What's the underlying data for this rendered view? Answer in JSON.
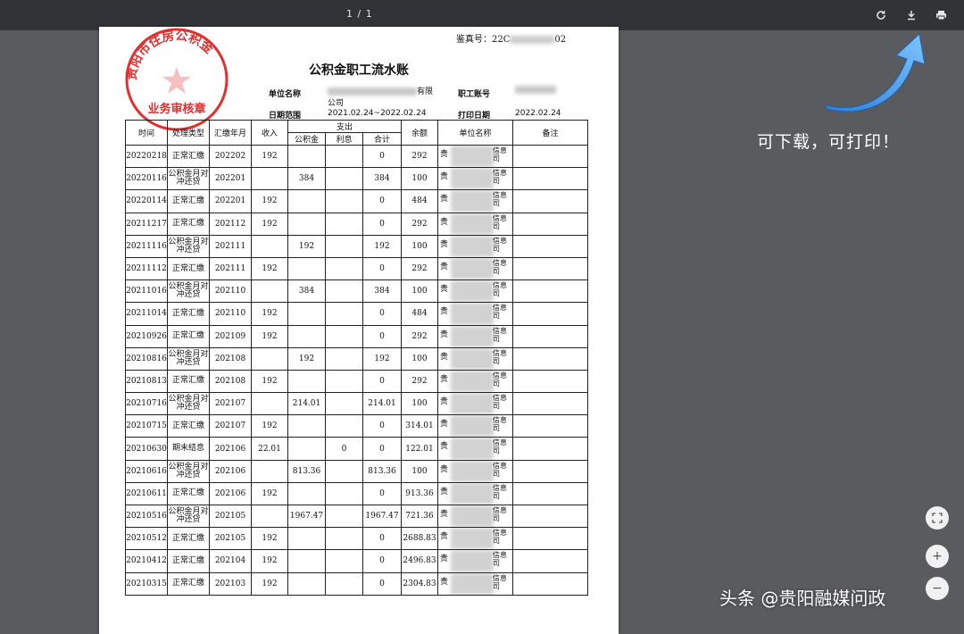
{
  "toolbar": {
    "page_count": "1 / 1",
    "rotate_icon": "rotate-icon",
    "download_icon": "download-icon",
    "print_icon": "print-icon"
  },
  "document": {
    "fax_label": "鉴真号：22C",
    "fax_suffix": "02",
    "seal_text": "贵阳市住房公积金",
    "seal_subtext": "业务审核章",
    "title": "公积金职工流水账",
    "meta": {
      "unit_label": "单位名称",
      "unit_value_a": "有限",
      "unit_value_b": "公司",
      "account_label": "职工账号",
      "date_range_label": "日期范围",
      "date_range_value": "2021.02.24~2022.02.24",
      "print_date_label": "打印日期",
      "print_date_value": "2022.02.24"
    },
    "headers": {
      "time": "时间",
      "type": "处理类型",
      "month": "汇缴年月",
      "income": "收入",
      "expense": "支出",
      "fund": "公积金",
      "interest": "利息",
      "total": "合计",
      "balance": "余额",
      "unit": "单位名称",
      "remark": "备注"
    },
    "unit_prefix": "贵",
    "unit_suffix": "信息司",
    "rows": [
      {
        "time": "20220218",
        "type": "正常汇缴",
        "month": "202202",
        "income": "192",
        "fund": "",
        "interest": "",
        "total": "0",
        "balance": "292"
      },
      {
        "time": "20220116",
        "type": "公积金月对冲还贷",
        "month": "202201",
        "income": "",
        "fund": "384",
        "interest": "",
        "total": "384",
        "balance": "100"
      },
      {
        "time": "20220114",
        "type": "正常汇缴",
        "month": "202201",
        "income": "192",
        "fund": "",
        "interest": "",
        "total": "0",
        "balance": "484"
      },
      {
        "time": "20211217",
        "type": "正常汇缴",
        "month": "202112",
        "income": "192",
        "fund": "",
        "interest": "",
        "total": "0",
        "balance": "292"
      },
      {
        "time": "20211116",
        "type": "公积金月对冲还贷",
        "month": "202111",
        "income": "",
        "fund": "192",
        "interest": "",
        "total": "192",
        "balance": "100"
      },
      {
        "time": "20211112",
        "type": "正常汇缴",
        "month": "202111",
        "income": "192",
        "fund": "",
        "interest": "",
        "total": "0",
        "balance": "292"
      },
      {
        "time": "20211016",
        "type": "公积金月对冲还贷",
        "month": "202110",
        "income": "",
        "fund": "384",
        "interest": "",
        "total": "384",
        "balance": "100"
      },
      {
        "time": "20211014",
        "type": "正常汇缴",
        "month": "202110",
        "income": "192",
        "fund": "",
        "interest": "",
        "total": "0",
        "balance": "484"
      },
      {
        "time": "20210926",
        "type": "正常汇缴",
        "month": "202109",
        "income": "192",
        "fund": "",
        "interest": "",
        "total": "0",
        "balance": "292"
      },
      {
        "time": "20210816",
        "type": "公积金月对冲还贷",
        "month": "202108",
        "income": "",
        "fund": "192",
        "interest": "",
        "total": "192",
        "balance": "100"
      },
      {
        "time": "20210813",
        "type": "正常汇缴",
        "month": "202108",
        "income": "192",
        "fund": "",
        "interest": "",
        "total": "0",
        "balance": "292"
      },
      {
        "time": "20210716",
        "type": "公积金月对冲还贷",
        "month": "202107",
        "income": "",
        "fund": "214.01",
        "interest": "",
        "total": "214.01",
        "balance": "100"
      },
      {
        "time": "20210715",
        "type": "正常汇缴",
        "month": "202107",
        "income": "192",
        "fund": "",
        "interest": "",
        "total": "0",
        "balance": "314.01"
      },
      {
        "time": "20210630",
        "type": "期末结息",
        "month": "202106",
        "income": "22.01",
        "fund": "",
        "interest": "0",
        "total": "0",
        "balance": "122.01"
      },
      {
        "time": "20210616",
        "type": "公积金月对冲还贷",
        "month": "202106",
        "income": "",
        "fund": "813.36",
        "interest": "",
        "total": "813.36",
        "balance": "100"
      },
      {
        "time": "20210611",
        "type": "正常汇缴",
        "month": "202106",
        "income": "192",
        "fund": "",
        "interest": "",
        "total": "0",
        "balance": "913.36"
      },
      {
        "time": "20210516",
        "type": "公积金月对冲还贷",
        "month": "202105",
        "income": "",
        "fund": "1967.47",
        "interest": "",
        "total": "1967.47",
        "balance": "721.36"
      },
      {
        "time": "20210512",
        "type": "正常汇缴",
        "month": "202105",
        "income": "192",
        "fund": "",
        "interest": "",
        "total": "0",
        "balance": "2688.83"
      },
      {
        "time": "20210412",
        "type": "正常汇缴",
        "month": "202104",
        "income": "192",
        "fund": "",
        "interest": "",
        "total": "0",
        "balance": "2496.83"
      },
      {
        "time": "20210315",
        "type": "正常汇缴",
        "month": "202103",
        "income": "192",
        "fund": "",
        "interest": "",
        "total": "0",
        "balance": "2304.83"
      }
    ]
  },
  "annotation": {
    "text": "可下载，可打印！",
    "arrow_color": "#3a8ee6"
  },
  "side_controls": {
    "fit_icon": "fit-page-icon",
    "zoom_in_label": "+",
    "zoom_out_label": "−"
  },
  "watermark": "头条 @贵阳融媒问政"
}
